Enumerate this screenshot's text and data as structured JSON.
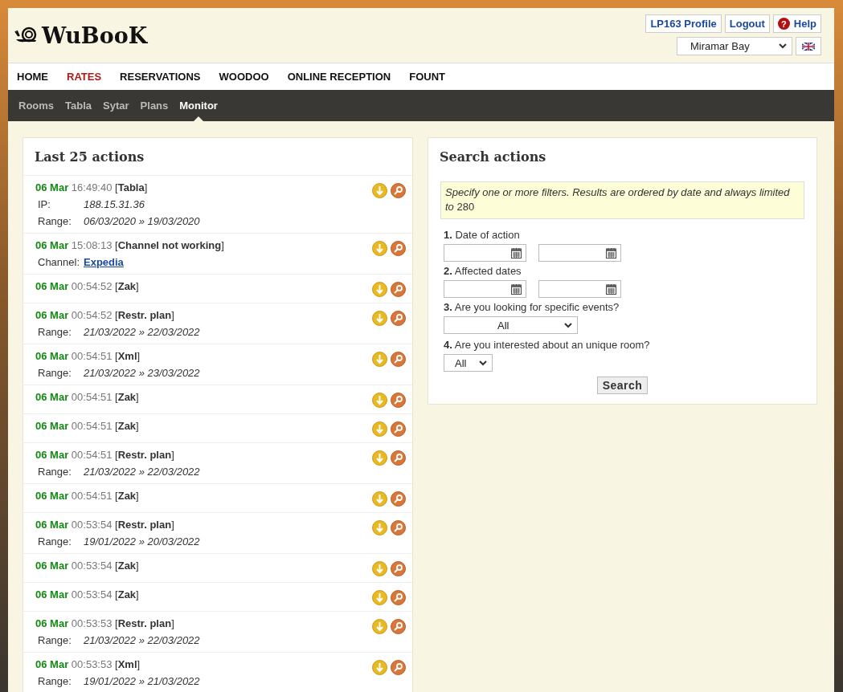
{
  "logo": {
    "text": "WuBooK"
  },
  "header_links": [
    {
      "label": "LP163 Profile",
      "kind": "plain"
    },
    {
      "label": "Logout",
      "kind": "plain"
    },
    {
      "label": "Help",
      "kind": "help",
      "icon": "?"
    }
  ],
  "property_select": {
    "value": "Miramar Bay"
  },
  "main_nav": [
    {
      "label": "HOME",
      "selected": false
    },
    {
      "label": "RATES",
      "selected": true
    },
    {
      "label": "RESERVATIONS",
      "selected": false
    },
    {
      "label": "WOODOO",
      "selected": false
    },
    {
      "label": "ONLINE RECEPTION",
      "selected": false
    },
    {
      "label": "FOUNT",
      "selected": false
    }
  ],
  "sub_nav": [
    {
      "label": "Rooms",
      "selected": false
    },
    {
      "label": "Tabla",
      "selected": false
    },
    {
      "label": "Sytar",
      "selected": false
    },
    {
      "label": "Plans",
      "selected": false
    },
    {
      "label": "Monitor",
      "selected": true
    }
  ],
  "actions_panel": {
    "title": "Last 25 actions",
    "rows": [
      {
        "date": "06 Mar",
        "time": "16:49:40",
        "type": "[**Tabla**]",
        "details": [
          {
            "label": "IP:",
            "value": "188.15.31.36",
            "kind": "text"
          },
          {
            "label": "Range:",
            "value": "06/03/2020 » 19/03/2020",
            "kind": "text"
          }
        ]
      },
      {
        "date": "06 Mar",
        "time": "15:08:13",
        "type": "[**Channel not working**]",
        "details": [
          {
            "label": "Channel:",
            "value": "Expedia",
            "kind": "link"
          }
        ]
      },
      {
        "date": "06 Mar",
        "time": "00:54:52",
        "type": "[**Zak**]",
        "details": []
      },
      {
        "date": "06 Mar",
        "time": "00:54:52",
        "type": "[**Restr. plan**]",
        "details": [
          {
            "label": "Range:",
            "value": "21/03/2022 » 22/03/2022",
            "kind": "text"
          }
        ]
      },
      {
        "date": "06 Mar",
        "time": "00:54:51",
        "type": "[**Xml**]",
        "details": [
          {
            "label": "Range:",
            "value": "21/03/2022 » 23/03/2022",
            "kind": "text"
          }
        ]
      },
      {
        "date": "06 Mar",
        "time": "00:54:51",
        "type": "[**Zak**]",
        "details": []
      },
      {
        "date": "06 Mar",
        "time": "00:54:51",
        "type": "[**Zak**]",
        "details": []
      },
      {
        "date": "06 Mar",
        "time": "00:54:51",
        "type": "[**Restr. plan**]",
        "details": [
          {
            "label": "Range:",
            "value": "21/03/2022 » 22/03/2022",
            "kind": "text"
          }
        ]
      },
      {
        "date": "06 Mar",
        "time": "00:54:51",
        "type": "[**Zak**]",
        "details": []
      },
      {
        "date": "06 Mar",
        "time": "00:53:54",
        "type": "[**Restr. plan**]",
        "details": [
          {
            "label": "Range:",
            "value": "19/01/2022 » 20/03/2022",
            "kind": "text"
          }
        ]
      },
      {
        "date": "06 Mar",
        "time": "00:53:54",
        "type": "[**Zak**]",
        "details": []
      },
      {
        "date": "06 Mar",
        "time": "00:53:54",
        "type": "[**Zak**]",
        "details": []
      },
      {
        "date": "06 Mar",
        "time": "00:53:53",
        "type": "[**Restr. plan**]",
        "details": [
          {
            "label": "Range:",
            "value": "21/03/2022 » 22/03/2022",
            "kind": "text"
          }
        ]
      },
      {
        "date": "06 Mar",
        "time": "00:53:53",
        "type": "[**Xml**]",
        "details": [
          {
            "label": "Range:",
            "value": "19/01/2022 » 21/03/2022",
            "kind": "text"
          }
        ]
      }
    ]
  },
  "search_panel": {
    "title": "Search actions",
    "notice": "*Specify one or more filters. Results are ordered by date and always limited to* 280",
    "filters": [
      {
        "number": "1.",
        "label": "Date of action",
        "kind": "date-range"
      },
      {
        "number": "2.",
        "label": "Affected dates",
        "kind": "date-range"
      },
      {
        "number": "3.",
        "label": "Are you looking for specific events?",
        "kind": "select-wide",
        "value": "All"
      },
      {
        "number": "4.",
        "label": "Are you interested about an unique room?",
        "kind": "select-narrow",
        "value": "All"
      }
    ],
    "button": "Search"
  }
}
